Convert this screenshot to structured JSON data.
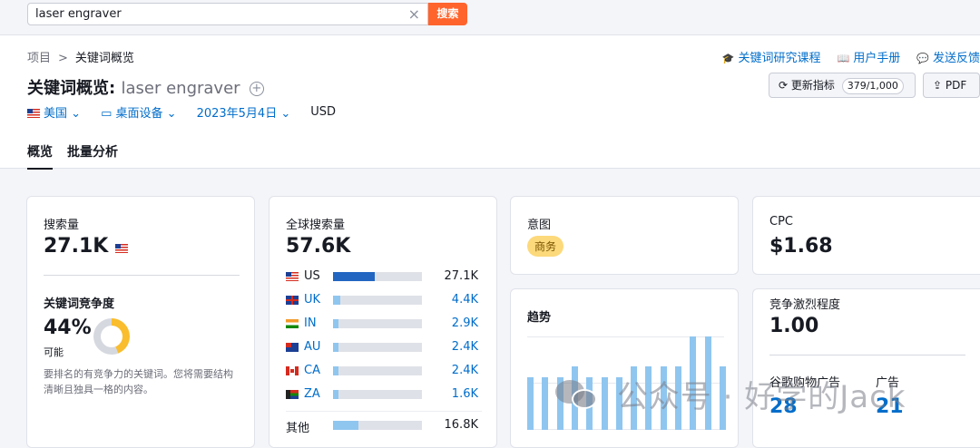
{
  "search": {
    "value": "laser engraver",
    "clear_icon": "×",
    "button": "搜索"
  },
  "breadcrumb": {
    "root": "项目",
    "sep": ">",
    "current": "关键词概览"
  },
  "header_links": [
    {
      "label": "关键词研究课程",
      "icon": "graduation-cap-icon",
      "glyph": "🎓"
    },
    {
      "label": "用户手册",
      "icon": "book-icon",
      "glyph": "📖"
    },
    {
      "label": "发送反馈",
      "icon": "message-icon",
      "glyph": "💬"
    }
  ],
  "title": {
    "prefix": "关键词概览:",
    "keyword": "laser engraver"
  },
  "actions": {
    "update_label": "更新指标",
    "counter": "379/1,000",
    "pdf_label": "PDF"
  },
  "filters": {
    "country": "美国",
    "device": "桌面设备",
    "date": "2023年5月4日",
    "currency": "USD"
  },
  "tabs": [
    "概览",
    "批量分析"
  ],
  "volume": {
    "label": "搜索量",
    "value": "27.1K"
  },
  "kd": {
    "label": "关键词竞争度",
    "value": "44%",
    "level": "可能",
    "percent": 44,
    "description": "要排名的有竞争力的关键词。您将需要结构清晰且独具一格的内容。"
  },
  "global_volume": {
    "label": "全球搜索量",
    "value": "57.6K",
    "rows": [
      {
        "code": "US",
        "value": "27.1K",
        "share": 0.47
      },
      {
        "code": "UK",
        "value": "4.4K",
        "share": 0.08
      },
      {
        "code": "IN",
        "value": "2.9K",
        "share": 0.05
      },
      {
        "code": "AU",
        "value": "2.4K",
        "share": 0.04
      },
      {
        "code": "CA",
        "value": "2.4K",
        "share": 0.04
      },
      {
        "code": "ZA",
        "value": "1.6K",
        "share": 0.03
      },
      {
        "code": "其他",
        "value": "16.8K",
        "share": 0.29
      }
    ]
  },
  "intent": {
    "label": "意图",
    "value": "商务"
  },
  "trend": {
    "label": "趋势",
    "values": [
      0.56,
      0.56,
      0.56,
      0.68,
      0.56,
      0.56,
      0.56,
      0.68,
      0.68,
      0.68,
      0.68,
      1.0,
      1.0,
      0.68
    ]
  },
  "cpc": {
    "label": "CPC",
    "value": "$1.68"
  },
  "competition": {
    "label": "竞争激烈程度",
    "value": "1.00"
  },
  "ads": {
    "shopping_label": "谷歌购物广告",
    "shopping_value": "28",
    "ads_label": "广告",
    "ads_value": "21"
  },
  "watermark": {
    "text": "公众号 · 好学的Jack"
  },
  "colors": {
    "accent": "#ff642d",
    "link": "#006dca",
    "bar": "#8fc6ef",
    "bar_strong": "#2266c2",
    "kd": "#f9bd2d"
  }
}
